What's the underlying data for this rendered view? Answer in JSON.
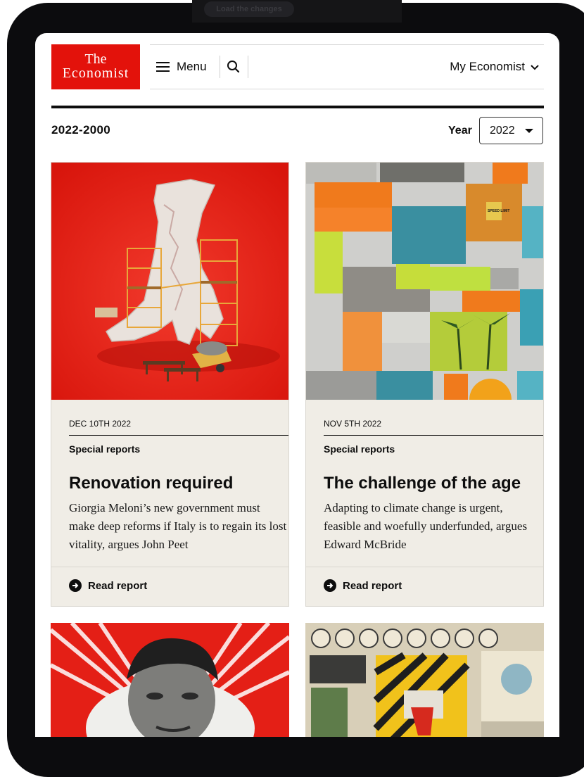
{
  "top_banner": {
    "text": "Load the changes"
  },
  "header": {
    "logo_line1": "The",
    "logo_line2": "Economist",
    "menu_label": "Menu",
    "my_economist_label": "My Economist"
  },
  "section": {
    "title": "2022-2000",
    "year_label": "Year",
    "year_selected": "2022"
  },
  "cards": [
    {
      "date": "DEC 10TH 2022",
      "kicker": "Special reports",
      "title": "Renovation required",
      "description": "Giorgia Meloni’s new government must make deep reforms if Italy is to regain its lost vitality, argues John Peet",
      "link": "Read report"
    },
    {
      "date": "NOV 5TH 2022",
      "kicker": "Special reports",
      "title": "The challenge of the age",
      "description": "Adapting to climate change is urgent, feasible and woefully underfunded, argues Edward McBride",
      "link": "Read report"
    }
  ],
  "image_signs": {
    "speed_limit": "SPEED LIMIT"
  },
  "colors": {
    "brand_red": "#e3120b",
    "card_bg": "#f0ede6",
    "device": "#0c0c0e"
  },
  "icons": [
    "menu-icon",
    "search-icon",
    "chevron-down-icon",
    "arrow-right-circle-icon"
  ]
}
